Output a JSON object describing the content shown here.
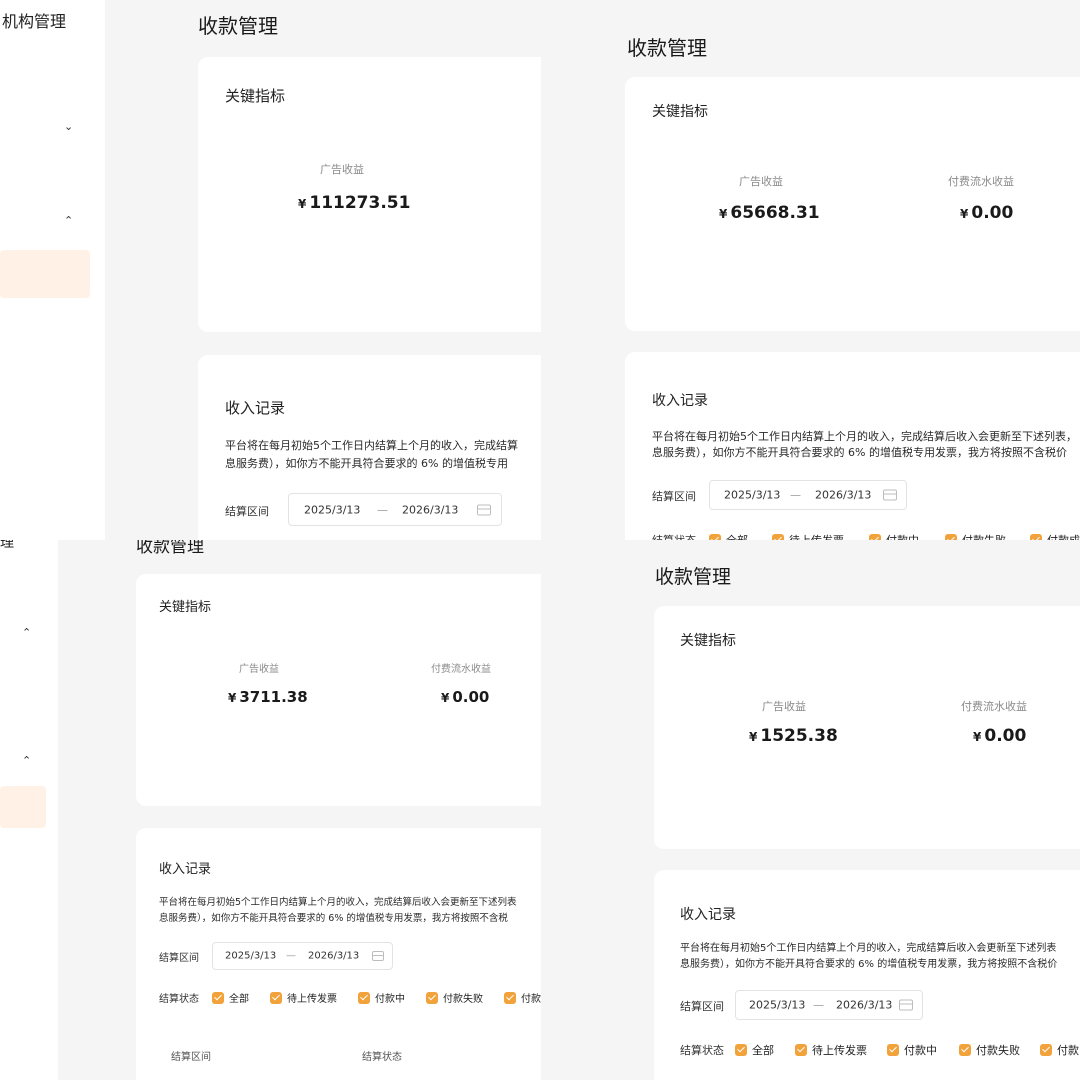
{
  "sidebar": {
    "org_mgmt": "机构管理",
    "org_mgmt_partial": "管理"
  },
  "page": {
    "title": "收款管理"
  },
  "metrics_card": {
    "title": "关键指标",
    "ad_label": "广告收益",
    "paid_label": "付费流水收益",
    "currency": "¥"
  },
  "values": {
    "p1_ad": "111273.51",
    "p2_ad": "65668.31",
    "p2_paid": "0.00",
    "p3_ad": "3711.38",
    "p3_paid": "0.00",
    "p4_ad": "1525.38",
    "p4_paid": "0.00"
  },
  "income": {
    "title": "收入记录",
    "desc_line1_full": "平台将在每月初始5个工作日内结算上个月的收入，完成结算后收入会更新至下述列表，",
    "desc_line2_full": "息服务费），如你方不能开具符合要求的 6% 的增值税专用发票，我方将按照不含税价",
    "p1_line1": "平台将在每月初始5个工作日内结算上个月的收入，完成结算",
    "p1_line2": "息服务费），如你方不能开具符合要求的 6% 的增值税专用",
    "p3_line1": "平台将在每月初始5个工作日内结算上个月的收入，完成结算后收入会更新至下述列表",
    "p3_line2": "息服务费），如你方不能开具符合要求的 6% 的增值税专用发票，我方将按照不含税",
    "p4_line1": "平台将在每月初始5个工作日内结算上个月的收入，完成结算后收入会更新至下述列表",
    "p4_line2": "息服务费），如你方不能开具符合要求的 6% 的增值税专用发票，我方将按照不含税价",
    "settle_range_label": "结算区间",
    "date_start": "2025/3/13",
    "date_sep": "—",
    "date_end": "2026/3/13",
    "status_label": "结算状态",
    "status_options": [
      "全部",
      "待上传发票",
      "付款中",
      "付款失败",
      "付款成"
    ],
    "status_options_p3": [
      "全部",
      "待上传发票",
      "付款中",
      "付款失败",
      "付款"
    ],
    "status_options_p4": [
      "全部",
      "待上传发票",
      "付款中",
      "付款失败",
      "付款"
    ],
    "table_headers": [
      "结算区间",
      "结算状态"
    ]
  },
  "colors": {
    "accent": "#f2a23a",
    "highlight": "#fff1e6",
    "background": "#f5f5f6"
  }
}
